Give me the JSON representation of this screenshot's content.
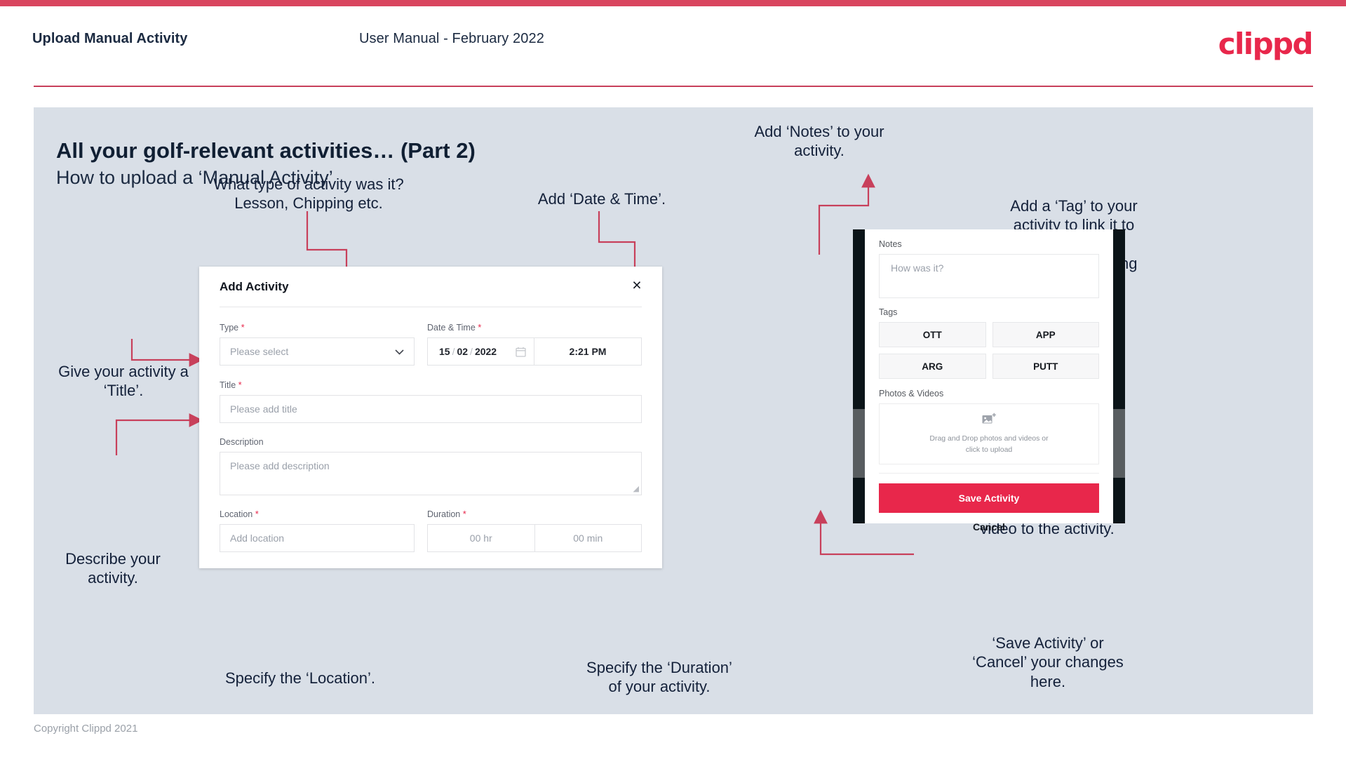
{
  "header": {
    "title": "Upload Manual Activity",
    "subtitle": "User Manual - February 2022",
    "logo": "clippd"
  },
  "slide": {
    "title": "All your golf-relevant activities… (Part 2)",
    "subtitle": "How to upload a ‘Manual Activity’"
  },
  "dialog": {
    "title": "Add Activity",
    "close_icon": "×",
    "fields": {
      "type": {
        "label": "Type",
        "required": "*",
        "placeholder": "Please select",
        "chevron": "⌄"
      },
      "datetime": {
        "label": "Date & Time",
        "required": "*",
        "day": "15",
        "month": "02",
        "year": "2022",
        "separator": "/",
        "time": "2:21 PM"
      },
      "title": {
        "label": "Title",
        "required": "*",
        "placeholder": "Please add title"
      },
      "description": {
        "label": "Description",
        "placeholder": "Please add description"
      },
      "location": {
        "label": "Location",
        "required": "*",
        "placeholder": "Add location"
      },
      "duration": {
        "label": "Duration",
        "required": "*",
        "hours": "00 hr",
        "minutes": "00 min"
      }
    }
  },
  "phone": {
    "notes": {
      "label": "Notes",
      "placeholder": "How was it?"
    },
    "tags": {
      "label": "Tags",
      "items": [
        "OTT",
        "APP",
        "ARG",
        "PUTT"
      ]
    },
    "photos": {
      "label": "Photos & Videos",
      "dropzone_text": "Drag and Drop photos and videos or\nclick to upload"
    },
    "save_label": "Save Activity",
    "cancel_label": "Cancel"
  },
  "annotations": {
    "type": "What type of activity was it?\nLesson, Chipping etc.",
    "datetime": "Add ‘Date & Time’.",
    "notes": "Add ‘Notes’ to your\nactivity.",
    "tag": "Add a ‘Tag’ to your\nactivity to link it to\nthe part of the\ngame you’re trying\nto improve.",
    "title": "Give your activity a\n‘Title’.",
    "description": "Describe your\nactivity.",
    "location": "Specify the ‘Location’.",
    "duration": "Specify the ‘Duration’\nof your activity.",
    "upload": "Upload a photo or\nvideo to the activity.",
    "save": "‘Save Activity’ or\n‘Cancel’ your changes\nhere."
  },
  "footer": {
    "copyright": "Copyright Clippd 2021"
  },
  "colors": {
    "brand": "#e8274b",
    "top_bar": "#d9455f",
    "slide_bg": "#d9dfe7",
    "annotation_line": "#c8405b",
    "text_dark": "#14213a"
  }
}
